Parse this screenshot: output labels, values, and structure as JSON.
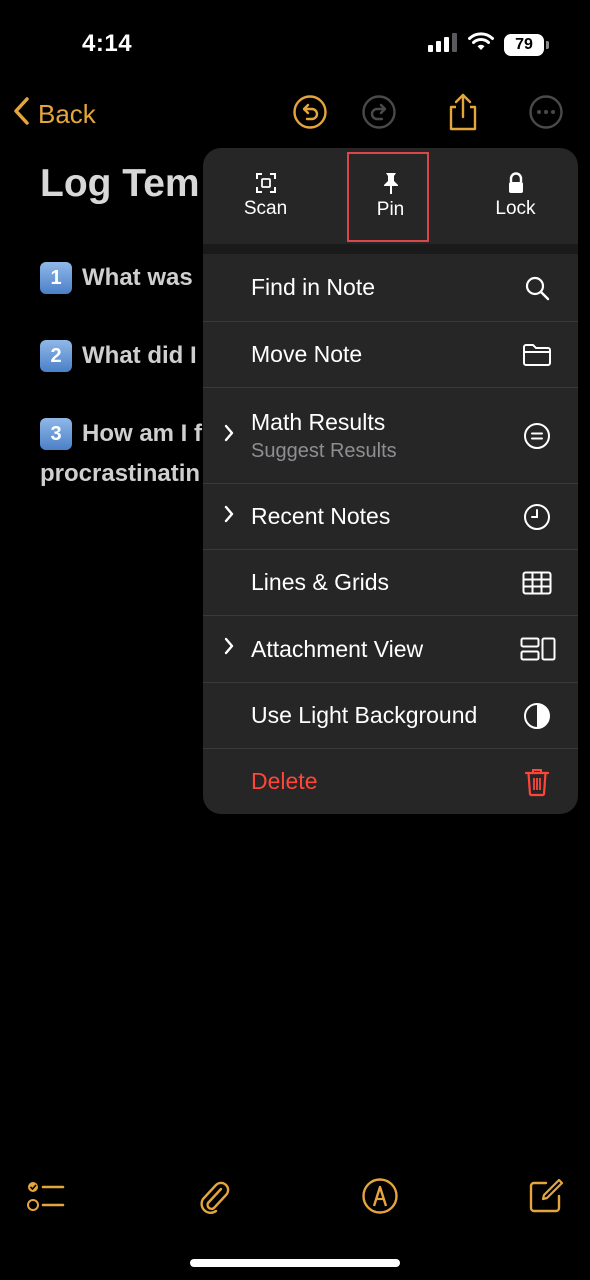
{
  "status": {
    "time": "4:14",
    "battery": "79"
  },
  "nav": {
    "back_label": "Back"
  },
  "note": {
    "title": "Log Tem",
    "lines": [
      {
        "num": "1",
        "text": "What was"
      },
      {
        "num": "2",
        "text": "What did I"
      },
      {
        "num": "3",
        "text": "How am I f"
      }
    ],
    "continuation": "procrastinatin"
  },
  "menu": {
    "top_actions": [
      {
        "label": "Scan",
        "icon": "scan-icon"
      },
      {
        "label": "Pin",
        "icon": "pin-icon",
        "highlighted": true
      },
      {
        "label": "Lock",
        "icon": "lock-icon"
      }
    ],
    "items": [
      {
        "label": "Find in Note",
        "icon": "magnifier-icon",
        "chevron": false
      },
      {
        "label": "Move Note",
        "icon": "folder-icon",
        "chevron": false
      },
      {
        "label": "Math Results",
        "sublabel": "Suggest Results",
        "icon": "equals-circle-icon",
        "chevron": true
      },
      {
        "label": "Recent Notes",
        "icon": "clock-icon",
        "chevron": true
      },
      {
        "label": "Lines & Grids",
        "icon": "grid-icon",
        "chevron": false
      },
      {
        "label": "Attachment View",
        "icon": "attachment-view-icon",
        "chevron": true
      },
      {
        "label": "Use Light Background",
        "icon": "half-circle-icon",
        "chevron": false
      },
      {
        "label": "Delete",
        "icon": "trash-icon",
        "chevron": false,
        "destructive": true
      }
    ]
  },
  "colors": {
    "accent": "#e5a53d",
    "destructive": "#ff453a",
    "menu_bg": "#262626",
    "highlight_box": "#d9474a"
  }
}
